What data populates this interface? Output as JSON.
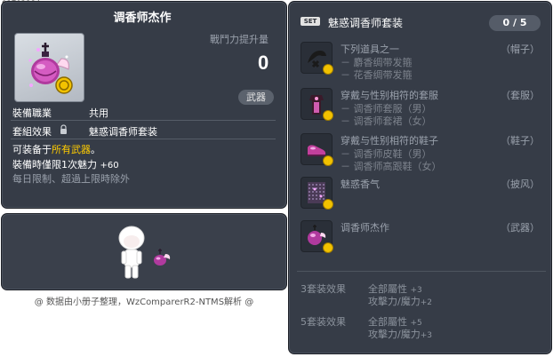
{
  "item_id": "01703184",
  "tooltip": {
    "title": "调香师杰作",
    "power_label": "戰鬥力提升量",
    "power_value": "0",
    "weapon_badge": "武器",
    "job_label": "裝備職業",
    "job_value": "共用",
    "set_effect_label": "套組效果",
    "set_effect_value": "魅惑调香师套装",
    "desc_line1_prefix": "可装备于",
    "desc_line1_highlight": "所有武器",
    "desc_line1_suffix": "。",
    "desc_line2_text": "裝備時僅限1次魅力",
    "desc_line2_bonus": "+60",
    "desc_line3": "每日限制、超過上限時除外"
  },
  "credit": "@ 数据由小册子整理，WzComparerR2-NTMS解析 @",
  "set_panel": {
    "badge": "SET",
    "name": "魅惑调香师套装",
    "count": "0 / 5",
    "pieces": [
      {
        "name": "下列道具之一",
        "subs": [
          "－ 麝香绸带发箍",
          "－ 花香绸带发箍"
        ],
        "slot": "（帽子）",
        "icon": "headband-icon"
      },
      {
        "name": "穿戴与性别相符的套服",
        "subs": [
          "－ 调香师套服（男）",
          "－ 调香师套裙（女）"
        ],
        "slot": "（套服）",
        "icon": "overall-icon"
      },
      {
        "name": "穿戴与性别相符的鞋子",
        "subs": [
          "－ 调香师皮鞋（男）",
          "－ 调香师高跟鞋（女）"
        ],
        "slot": "（鞋子）",
        "icon": "shoes-icon"
      },
      {
        "name": "魅惑香气",
        "subs": [],
        "slot": "（披风）",
        "icon": "cape-icon"
      },
      {
        "name": "调香师杰作",
        "subs": [],
        "slot": "（武器）",
        "icon": "perfume-icon"
      }
    ],
    "bonuses": [
      {
        "tier": "3套装效果",
        "line1_label": "全部屬性",
        "line1_value": "+3",
        "line2_label": "攻擊力/魔力",
        "line2_value": "+2"
      },
      {
        "tier": "5套装效果",
        "line1_label": "全部屬性",
        "line1_value": "+5",
        "line2_label": "攻擊力/魔力",
        "line2_value": "+3"
      }
    ]
  },
  "colors": {
    "panel_bg": "#363c47",
    "highlight": "#ffcc00",
    "muted": "#9aa1ac"
  }
}
